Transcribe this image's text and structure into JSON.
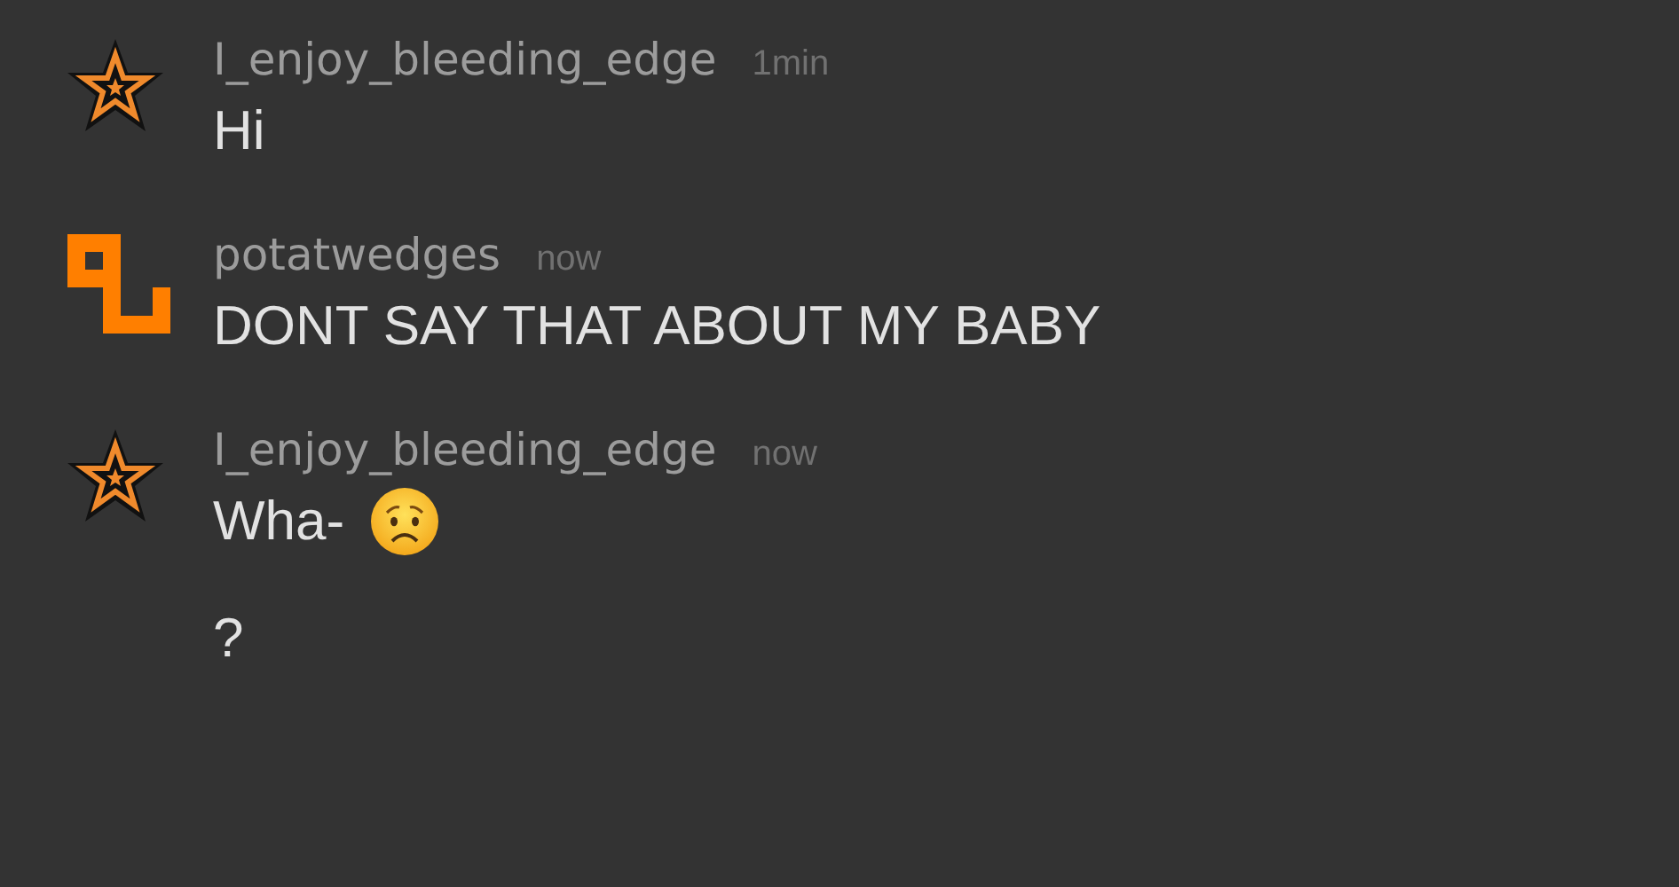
{
  "messages": [
    {
      "avatar": {
        "kind": "star"
      },
      "username": "I_enjoy_bleeding_edge",
      "time": "1min",
      "lines": [
        {
          "text": "Hi",
          "kind": "text"
        }
      ]
    },
    {
      "avatar": {
        "kind": "blocks"
      },
      "username": "potatwedges",
      "time": "now",
      "lines": [
        {
          "text": "DONT SAY THAT ABOUT MY BABY",
          "kind": "text"
        }
      ]
    },
    {
      "avatar": {
        "kind": "star"
      },
      "username": "I_enjoy_bleeding_edge",
      "time": "now",
      "lines": [
        {
          "text": "Wha-",
          "kind": "text_with_emoji"
        },
        {
          "text": "?",
          "kind": "text"
        }
      ]
    }
  ]
}
